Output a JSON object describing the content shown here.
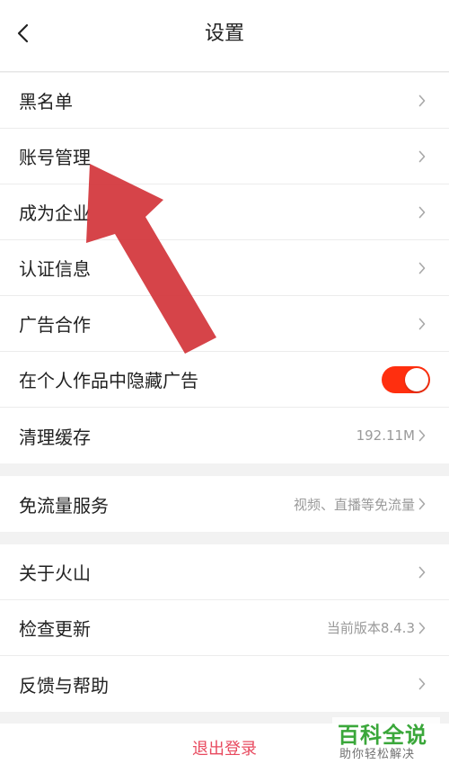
{
  "header": {
    "title": "设置",
    "back_icon": "chevron-left-icon"
  },
  "groups": [
    {
      "items": [
        {
          "label": "黑名单",
          "value": "",
          "control": "chevron"
        },
        {
          "label": "账号管理",
          "value": "",
          "control": "chevron"
        },
        {
          "label": "成为企业",
          "value": "",
          "control": "chevron"
        },
        {
          "label": "认证信息",
          "value": "",
          "control": "chevron"
        },
        {
          "label": "广告合作",
          "value": "",
          "control": "chevron"
        },
        {
          "label": "在个人作品中隐藏广告",
          "value": "",
          "control": "toggle",
          "toggle_on": true
        },
        {
          "label": "清理缓存",
          "value": "192.11M",
          "control": "chevron"
        }
      ]
    },
    {
      "items": [
        {
          "label": "免流量服务",
          "value": "视频、直播等免流量",
          "control": "chevron"
        }
      ]
    },
    {
      "items": [
        {
          "label": "关于火山",
          "value": "",
          "control": "chevron"
        },
        {
          "label": "检查更新",
          "value": "当前版本8.4.3",
          "control": "chevron"
        },
        {
          "label": "反馈与帮助",
          "value": "",
          "control": "chevron"
        }
      ]
    }
  ],
  "logout": {
    "label": "退出登录"
  },
  "watermark": {
    "title": "百科全说",
    "subtitle": "助你轻松解决"
  },
  "colors": {
    "toggle_on": "#ff2f0f",
    "logout_text": "#e84a5f",
    "annotation_arrow": "#d43a3f",
    "watermark_green": "#2aa02a"
  },
  "annotation": {
    "icon": "red-arrow-pointer"
  }
}
